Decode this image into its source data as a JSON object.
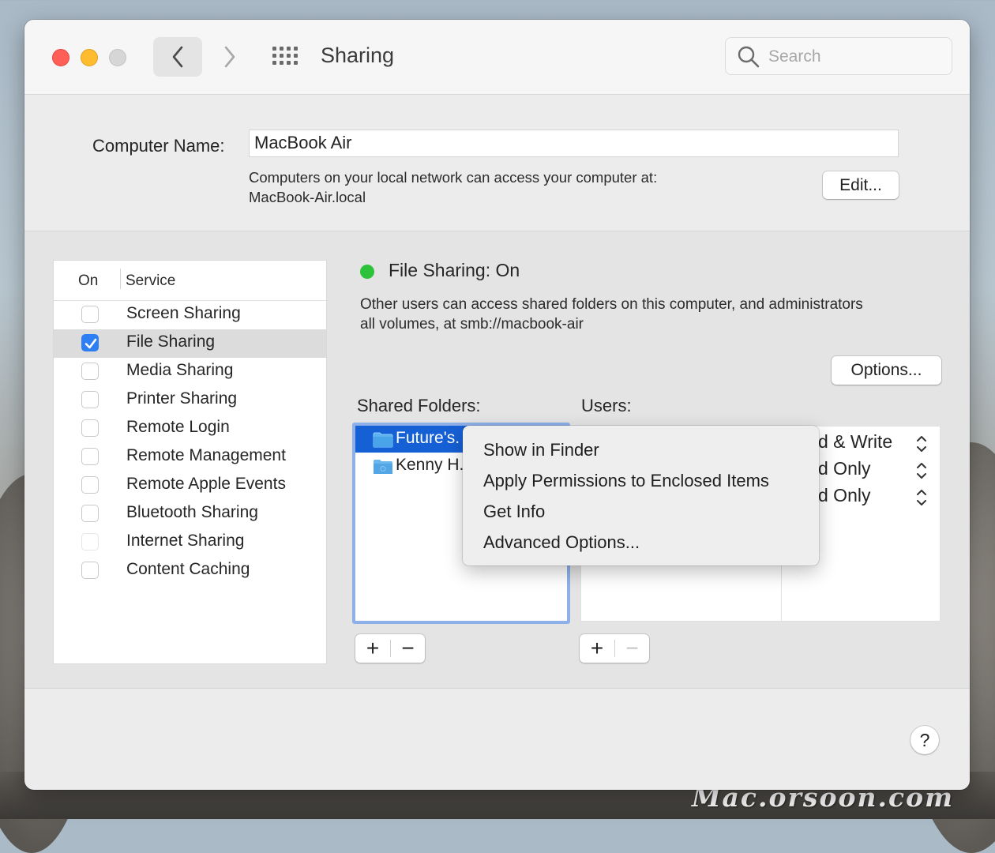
{
  "window": {
    "title": "Sharing"
  },
  "search": {
    "placeholder": "Search"
  },
  "computer": {
    "label": "Computer Name:",
    "name": "MacBook Air",
    "desc_line1": "Computers on your local network can access your computer at:",
    "desc_line2": "MacBook-Air.local",
    "edit_label": "Edit..."
  },
  "services": {
    "header_on": "On",
    "header_service": "Service",
    "items": [
      {
        "label": "Screen Sharing",
        "checked": false
      },
      {
        "label": "File Sharing",
        "checked": true
      },
      {
        "label": "Media Sharing",
        "checked": false
      },
      {
        "label": "Printer Sharing",
        "checked": false
      },
      {
        "label": "Remote Login",
        "checked": false
      },
      {
        "label": "Remote Management",
        "checked": false
      },
      {
        "label": "Remote Apple Events",
        "checked": false
      },
      {
        "label": "Bluetooth Sharing",
        "checked": false
      },
      {
        "label": "Internet Sharing",
        "checked": false
      },
      {
        "label": "Content Caching",
        "checked": false
      }
    ]
  },
  "status": {
    "title": "File Sharing: On",
    "desc_line1": "Other users can access shared folders on this computer, and administrators",
    "desc_line2": "all volumes, at smb://macbook-air",
    "color": "#2dc23b"
  },
  "options_label": "Options...",
  "shared_folders": {
    "label": "Shared Folders:",
    "items": [
      "Future's.",
      "Kenny H."
    ]
  },
  "users": {
    "label": "Users:",
    "permissions": [
      "d & Write",
      "d Only",
      "d Only"
    ]
  },
  "context_menu": {
    "items": [
      "Show in Finder",
      "Apply Permissions to Enclosed Items",
      "Get Info",
      "Advanced Options..."
    ]
  },
  "controls": {
    "plus": "+",
    "minus": "−",
    "help": "?"
  },
  "watermark": "Mac.orsoon.com",
  "colors": {
    "accent": "#1660d6",
    "checkbox": "#2f7ff4",
    "status_on": "#2dc23b"
  }
}
